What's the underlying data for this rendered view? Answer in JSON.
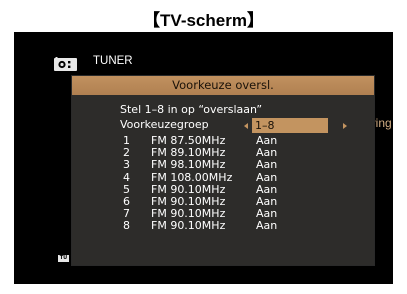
{
  "caption": "【TV-scherm】",
  "source": {
    "icon": "radio-icon",
    "label": "TUNER"
  },
  "background_text": "aying",
  "dialog": {
    "title": "Voorkeuze oversl.",
    "help_line1": "Stel 1–8 in op “overslaan”",
    "help_line2": "Voorkeuzegroep",
    "group_value": "1–8",
    "presets": [
      {
        "num": "1",
        "freq": "FM 87.50MHz",
        "state": "Aan"
      },
      {
        "num": "2",
        "freq": "FM 89.10MHz",
        "state": "Aan"
      },
      {
        "num": "3",
        "freq": "FM 98.10MHz",
        "state": "Aan"
      },
      {
        "num": "4",
        "freq": "FM 108.00MHz",
        "state": "Aan"
      },
      {
        "num": "5",
        "freq": "FM 90.10MHz",
        "state": "Aan"
      },
      {
        "num": "6",
        "freq": "FM 90.10MHz",
        "state": "Aan"
      },
      {
        "num": "7",
        "freq": "FM 90.10MHz",
        "state": "Aan"
      },
      {
        "num": "8",
        "freq": "FM 90.10MHz",
        "state": "Aan"
      }
    ]
  },
  "badge": "TU",
  "colors": {
    "accent": "#c39460",
    "dialog_bg": "#2d2c2a",
    "screen_bg": "#000000",
    "background_text": "#d2ae84"
  }
}
